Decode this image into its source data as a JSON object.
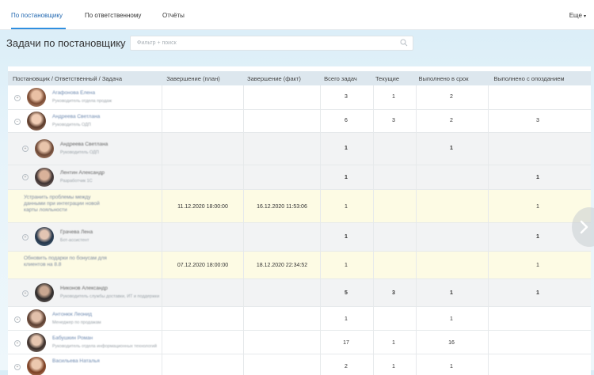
{
  "nav": {
    "tabs": [
      "По постановщику",
      "По ответственному",
      "Отчёты"
    ],
    "more": "Еще"
  },
  "page": {
    "title": "Задачи по постановщику",
    "search_placeholder": "Фильтр + поиск"
  },
  "table": {
    "headers": [
      "Постановщик / Ответственный / Задача",
      "Завершение (план)",
      "Завершение (факт)",
      "Всего задач",
      "Текущие",
      "Выполнено в срок",
      "Выполнено с опозданием"
    ],
    "rows": [
      {
        "type": "person",
        "name": "Агафонова Елена",
        "role": "Руководитель отдела продаж",
        "total": "3",
        "current": "1",
        "ontime": "2",
        "late": ""
      },
      {
        "type": "person",
        "name": "Андреева Светлана",
        "role": "Руководитель ОДП",
        "total": "6",
        "current": "3",
        "ontime": "2",
        "late": "3"
      },
      {
        "type": "sub",
        "name": "Андреева Светлана",
        "role": "Руководитель ОДП",
        "total": "1",
        "current": "",
        "ontime": "1",
        "late": ""
      },
      {
        "type": "sub",
        "name": "Лентин Александр",
        "role": "Разработчик 1С",
        "total": "1",
        "current": "",
        "ontime": "",
        "late": "1"
      },
      {
        "type": "task",
        "name": "Устранить проблемы между данными при интеграции новой карты лояльности",
        "plan": "11.12.2020 18:00:00",
        "fact": "16.12.2020 11:53:06",
        "total": "1",
        "late": "1"
      },
      {
        "type": "sub",
        "name": "Грачева Лена",
        "role": "Бот-ассистент",
        "total": "1",
        "current": "",
        "ontime": "",
        "late": "1"
      },
      {
        "type": "task",
        "name": "Обновить подарки по бонусам для клиентов на 8.8",
        "plan": "07.12.2020 18:00:00",
        "fact": "18.12.2020 22:34:52",
        "total": "1",
        "late": "1"
      },
      {
        "type": "sub",
        "name": "Никонов Александр",
        "role": "Руководитель службы доставки, ИТ и поддержки",
        "total": "5",
        "current": "3",
        "ontime": "1",
        "late": "1"
      },
      {
        "type": "person",
        "name": "Антонюк Леонид",
        "role": "Менеджер по продажам",
        "total": "1",
        "current": "",
        "ontime": "1",
        "late": ""
      },
      {
        "type": "person",
        "name": "Бабушкин Роман",
        "role": "Руководитель отдела информационных технологий",
        "total": "17",
        "current": "1",
        "ontime": "16",
        "late": ""
      },
      {
        "type": "person",
        "name": "Васильева Наталья",
        "role": "",
        "total": "2",
        "current": "1",
        "ontime": "1",
        "late": ""
      }
    ]
  },
  "colors": {
    "accent": "#2f8fe0",
    "header_bg": "#dde7ee",
    "task_bg": "#fdfbe4",
    "sub_bg": "#f2f3f4"
  }
}
